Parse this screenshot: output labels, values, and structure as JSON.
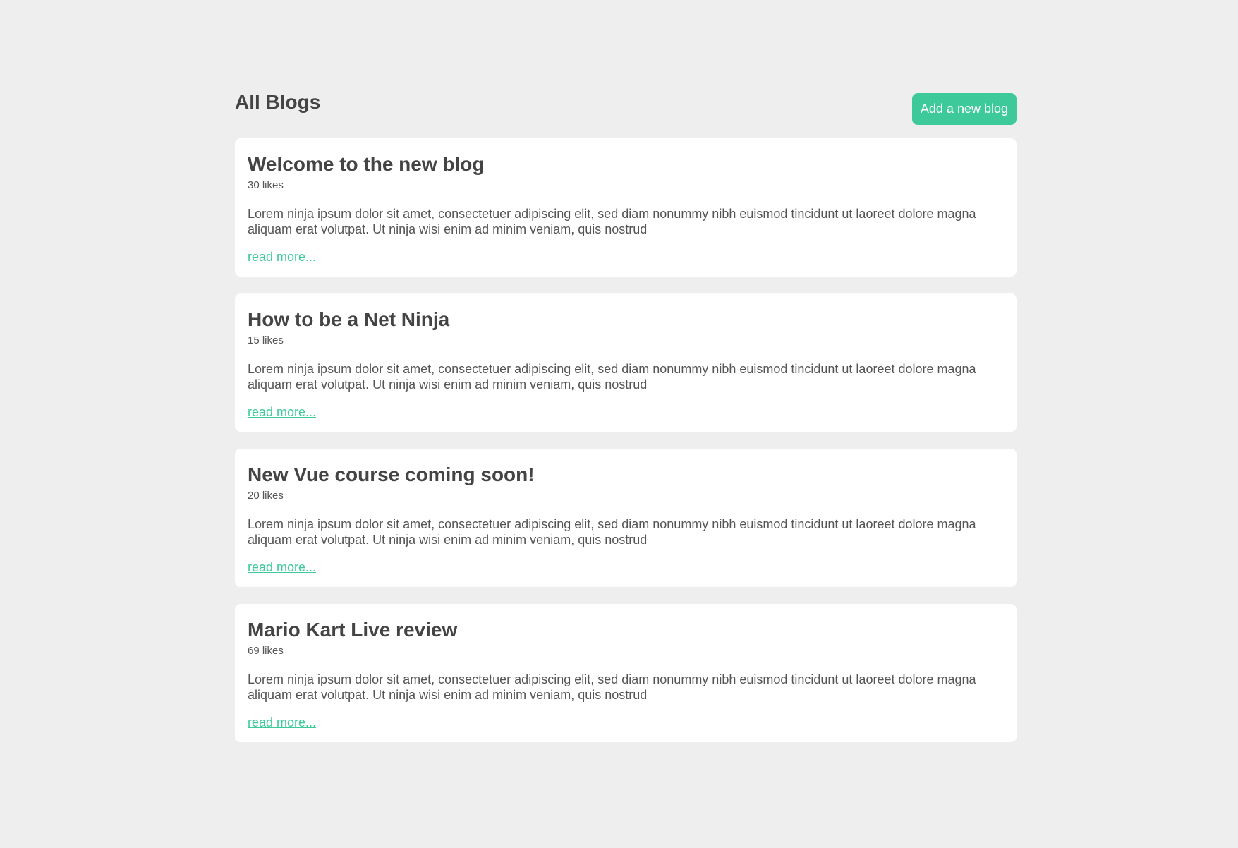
{
  "header": {
    "title": "All Blogs",
    "add_button_label": "Add a new blog"
  },
  "blogs": [
    {
      "title": "Welcome to the new blog",
      "likes": "30 likes",
      "body": "Lorem ninja ipsum dolor sit amet, consectetuer adipiscing elit, sed diam nonummy nibh euismod tincidunt ut laoreet dolore magna aliquam erat volutpat. Ut ninja wisi enim ad minim veniam, quis nostrud",
      "read_more": "read more..."
    },
    {
      "title": "How to be a Net Ninja",
      "likes": "15 likes",
      "body": "Lorem ninja ipsum dolor sit amet, consectetuer adipiscing elit, sed diam nonummy nibh euismod tincidunt ut laoreet dolore magna aliquam erat volutpat. Ut ninja wisi enim ad minim veniam, quis nostrud",
      "read_more": "read more..."
    },
    {
      "title": "New Vue course coming soon!",
      "likes": "20 likes",
      "body": "Lorem ninja ipsum dolor sit amet, consectetuer adipiscing elit, sed diam nonummy nibh euismod tincidunt ut laoreet dolore magna aliquam erat volutpat. Ut ninja wisi enim ad minim veniam, quis nostrud",
      "read_more": "read more..."
    },
    {
      "title": "Mario Kart Live review",
      "likes": "69 likes",
      "body": "Lorem ninja ipsum dolor sit amet, consectetuer adipiscing elit, sed diam nonummy nibh euismod tincidunt ut laoreet dolore magna aliquam erat volutpat. Ut ninja wisi enim ad minim veniam, quis nostrud",
      "read_more": "read more..."
    }
  ],
  "colors": {
    "accent": "#3ec99a",
    "background": "#eeeeee",
    "card": "#ffffff",
    "text": "#444444"
  }
}
